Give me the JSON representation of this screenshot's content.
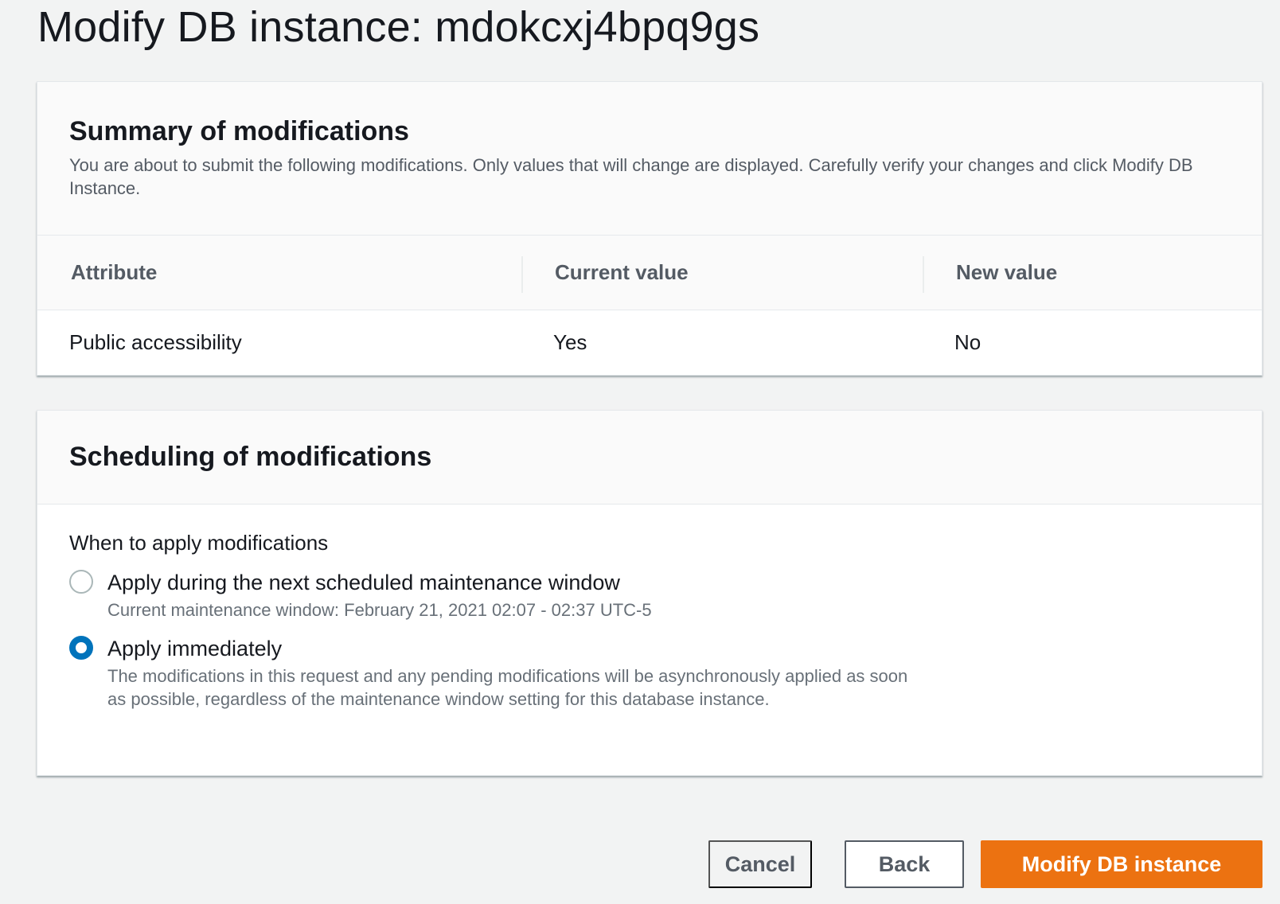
{
  "page": {
    "title": "Modify DB instance: mdokcxj4bpq9gs"
  },
  "summary": {
    "heading": "Summary of modifications",
    "description": "You are about to submit the following modifications. Only values that will change are displayed. Carefully verify your changes and click Modify DB Instance.",
    "columns": [
      "Attribute",
      "Current value",
      "New value"
    ],
    "rows": [
      {
        "attribute": "Public accessibility",
        "current": "Yes",
        "new": "No"
      }
    ]
  },
  "scheduling": {
    "heading": "Scheduling of modifications",
    "field_label": "When to apply modifications",
    "options": [
      {
        "label": "Apply during the next scheduled maintenance window",
        "description": "Current maintenance window: February 21, 2021 02:07 - 02:37 UTC-5",
        "selected": false
      },
      {
        "label": "Apply immediately",
        "description": "The modifications in this request and any pending modifications will be asynchronously applied as soon as possible, regardless of the maintenance window setting for this database instance.",
        "selected": true
      }
    ]
  },
  "footer": {
    "cancel_label": "Cancel",
    "back_label": "Back",
    "submit_label": "Modify DB instance"
  },
  "colors": {
    "primary_button": "#ec7211",
    "radio_selected": "#0073bb",
    "page_background": "#f2f3f3"
  }
}
